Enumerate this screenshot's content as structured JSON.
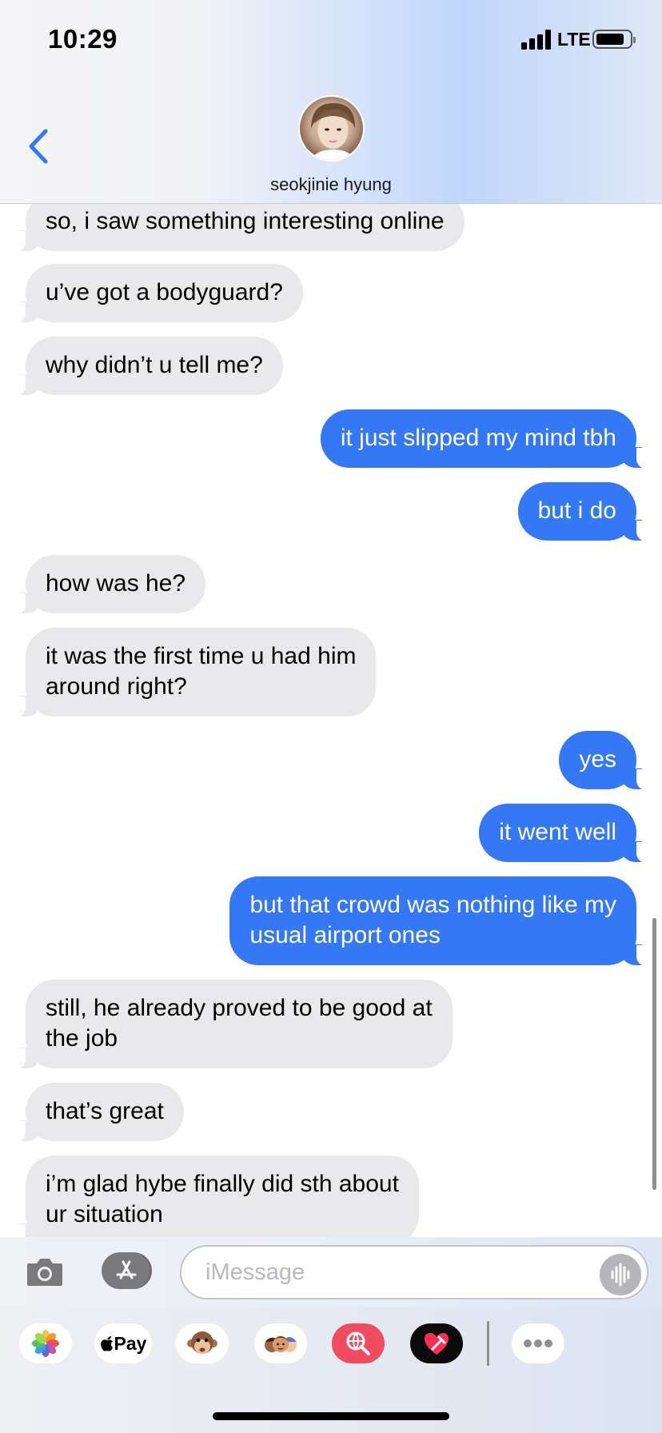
{
  "status_bar": {
    "time": "10:29",
    "network": "LTE"
  },
  "header": {
    "contact_name": "seokjinie hyung"
  },
  "messages": [
    {
      "text": "so, i saw something interesting online"
    },
    {
      "text": "u’ve got a bodyguard?"
    },
    {
      "text": "why didn’t u tell me?"
    },
    {
      "text": "it just slipped my mind tbh"
    },
    {
      "text": "but i do"
    },
    {
      "text": "how was he?"
    },
    {
      "line1": "it was the first time u had him",
      "line2": "around right?"
    },
    {
      "text": "yes"
    },
    {
      "text": "it went well"
    },
    {
      "line1": "but that crowd was nothing like my",
      "line2": "usual airport ones"
    },
    {
      "line1": "still, he already proved to be good at",
      "line2": "the job"
    },
    {
      "text": "that’s great"
    },
    {
      "line1": "i’m glad hybe finally did sth about",
      "line2": "ur situation"
    }
  ],
  "input": {
    "placeholder": "iMessage"
  },
  "drawer": {
    "apple_pay_label": "Pay"
  },
  "colors": {
    "outgoing": "#3478f6",
    "incoming": "#e9e9eb",
    "accent": "#3478f6"
  }
}
